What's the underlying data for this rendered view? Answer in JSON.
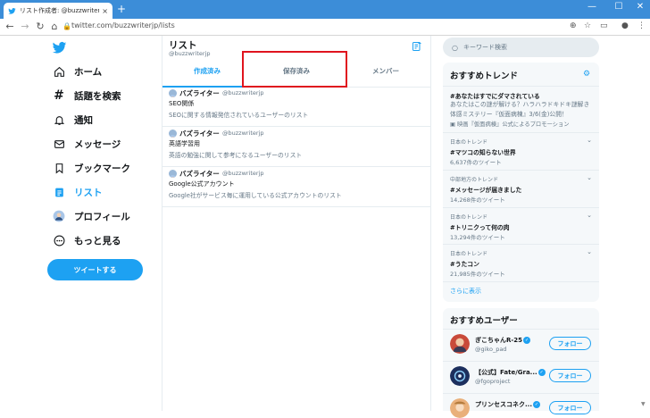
{
  "browser": {
    "tab_title": "リスト作成者: @buzzwriterjp / Twi",
    "tab_close": "×",
    "new_tab": "+",
    "url": "twitter.com/buzzwriterjp/lists",
    "min": "—",
    "max": "☐",
    "close": "✕"
  },
  "nav": {
    "items": [
      {
        "label": "ホーム",
        "icon": "home-icon"
      },
      {
        "label": "話題を検索",
        "icon": "hashtag-icon"
      },
      {
        "label": "通知",
        "icon": "bell-icon"
      },
      {
        "label": "メッセージ",
        "icon": "envelope-icon"
      },
      {
        "label": "ブックマーク",
        "icon": "bookmark-icon"
      },
      {
        "label": "リスト",
        "icon": "list-icon"
      },
      {
        "label": "プロフィール",
        "icon": "avatar-icon"
      },
      {
        "label": "もっと見る",
        "icon": "more-icon"
      }
    ],
    "tweet_button": "ツイートする"
  },
  "main": {
    "title": "リスト",
    "handle": "@buzzwriterjp",
    "tabs": [
      "作成済み",
      "保存済み",
      "メンバー"
    ],
    "lists": [
      {
        "author": "バズライター",
        "handle": "@buzzwriterjp",
        "name": "SEO関係",
        "desc": "SEOに関する情報発信されているユーザーのリスト"
      },
      {
        "author": "バズライター",
        "handle": "@buzzwriterjp",
        "name": "英語学習用",
        "desc": "英語の勉強に関して参考になるユーザーのリスト"
      },
      {
        "author": "バズライター",
        "handle": "@buzzwriterjp",
        "name": "Google公式アカウント",
        "desc": "Google社がサービス毎に運用している公式アカウントのリスト"
      }
    ]
  },
  "sidebar": {
    "search_placeholder": "キーワード検索",
    "trends_title": "おすすめトレンド",
    "promo": {
      "name": "#あなたはすでにダマされている",
      "desc": "あなたはこの謎が解ける？ハラハラドキドキ謎解き体感ミステリー『仮面病棟』3/6(金)公開！",
      "sponsor": "映画『仮面病棟』公式によるプロモーション"
    },
    "trends": [
      {
        "category": "日本のトレンド",
        "name": "#マツコの知らない世界",
        "count": "6,637件のツイート"
      },
      {
        "category": "中部地方のトレンド",
        "name": "#メッセージが届きました",
        "count": "14,268件のツイート"
      },
      {
        "category": "日本のトレンド",
        "name": "#トリニクって何の肉",
        "count": "13,294件のツイート"
      },
      {
        "category": "日本のトレンド",
        "name": "#うたコン",
        "count": "21,985件のツイート"
      }
    ],
    "show_more": "さらに表示",
    "users_title": "おすすめユーザー",
    "users": [
      {
        "name": "ぎこちゃんR-25",
        "handle": "@giko_pad",
        "button": "フォロー"
      },
      {
        "name": "【公式】Fate/Gra...",
        "handle": "@fgoproject",
        "button": "フォロー"
      },
      {
        "name": "プリンセスコネク...",
        "handle": "",
        "button": "フォロー"
      }
    ]
  },
  "colors": {
    "accent": "#1da1f2",
    "chrome": "#3c8dd8",
    "highlight": "#e0141e"
  }
}
